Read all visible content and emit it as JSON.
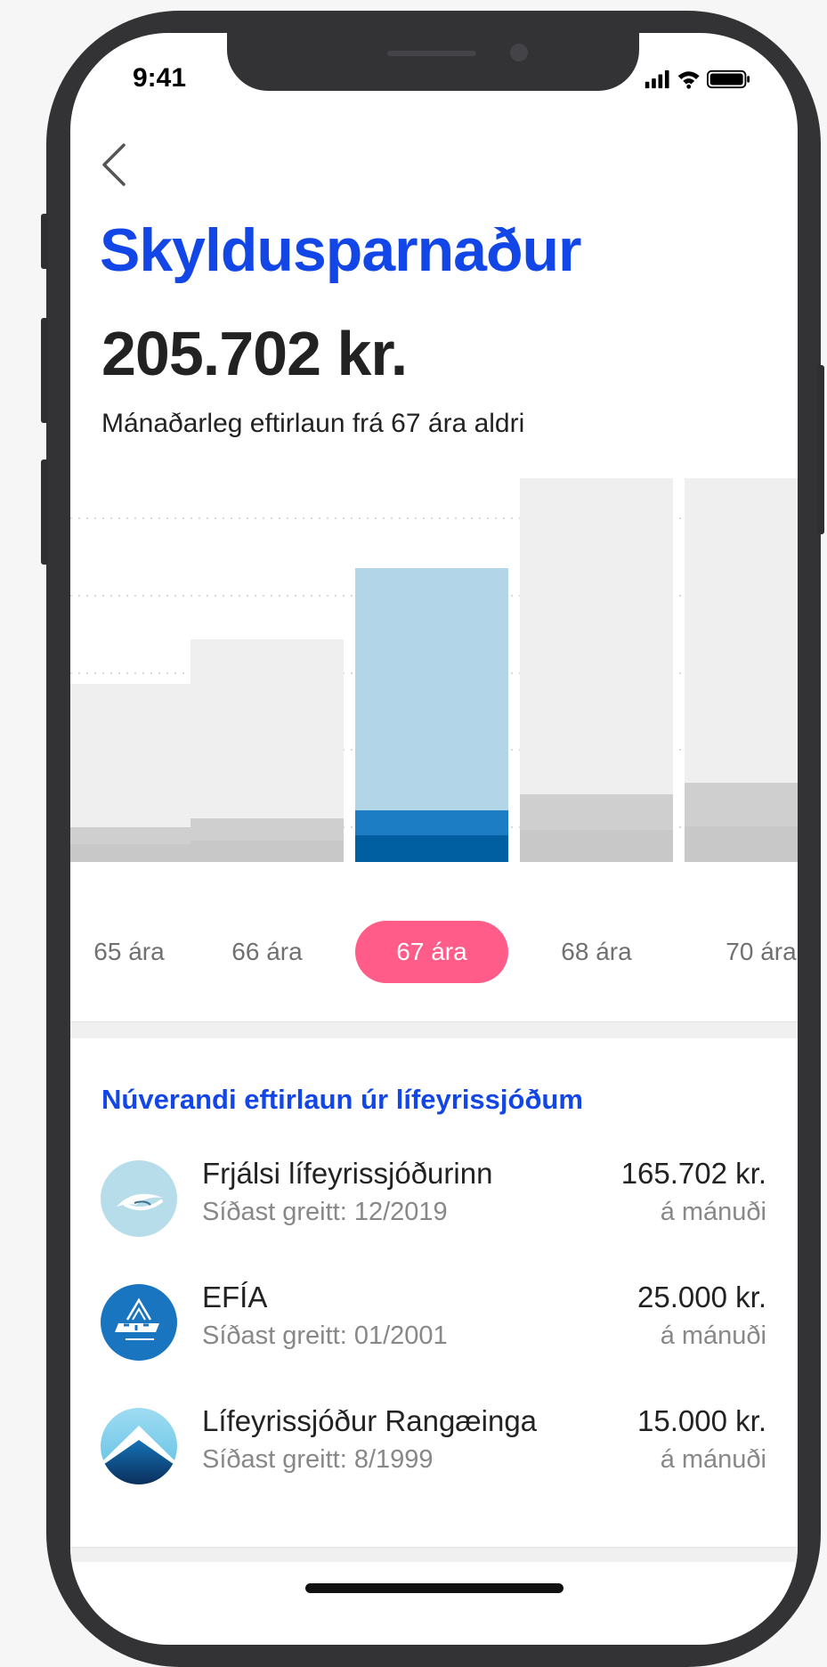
{
  "status_bar": {
    "time": "9:41"
  },
  "header": {
    "title": "Skyldusparnaður",
    "amount": "205.702 kr.",
    "subtitle": "Mánaðarleg eftirlaun frá 67 ára aldri"
  },
  "chart_data": {
    "type": "bar",
    "stacked": true,
    "categories": [
      "65 ára",
      "66 ára",
      "67 ára",
      "68 ára",
      "70 ára"
    ],
    "selected": "67 ára",
    "grid": true,
    "series": [
      {
        "values": [
          20,
          24,
          30,
          36,
          40
        ],
        "color_other": "#c8c8c8",
        "color_selected": "#005fa0"
      },
      {
        "values": [
          19,
          25,
          28,
          40,
          49
        ],
        "color_other": "#cfcfcf",
        "color_selected": "#1c7cc4"
      },
      {
        "values": [
          161,
          201,
          272,
          360,
          405
        ],
        "color_other": "#efefef",
        "color_selected": "#b2d6e8"
      }
    ]
  },
  "age_selector": {
    "options": [
      "65 ára",
      "66 ára",
      "67 ára",
      "68 ára",
      "70 ára"
    ],
    "selected_index": 2
  },
  "pension_section": {
    "title": "Núverandi eftirlaun úr lífeyrissjóðum",
    "funds": [
      {
        "name": "Frjálsi lífeyrissjóðurinn",
        "last_paid": "Síðast greitt: 12/2019",
        "amount": "165.702 kr.",
        "period": "á mánuði",
        "logo": "seagull-logo"
      },
      {
        "name": "EFÍA",
        "last_paid": "Síðast greitt: 01/2001",
        "amount": "25.000 kr.",
        "period": "á mánuði",
        "logo": "efia-logo"
      },
      {
        "name": "Lífeyrissjóður Rangæinga",
        "last_paid": "Síðast greitt: 8/1999",
        "amount": "15.000 kr.",
        "period": "á mánuði",
        "logo": "mountain-logo"
      }
    ]
  },
  "colors": {
    "brand_blue": "#1346e6",
    "accent_pink": "#ff5c8a"
  }
}
